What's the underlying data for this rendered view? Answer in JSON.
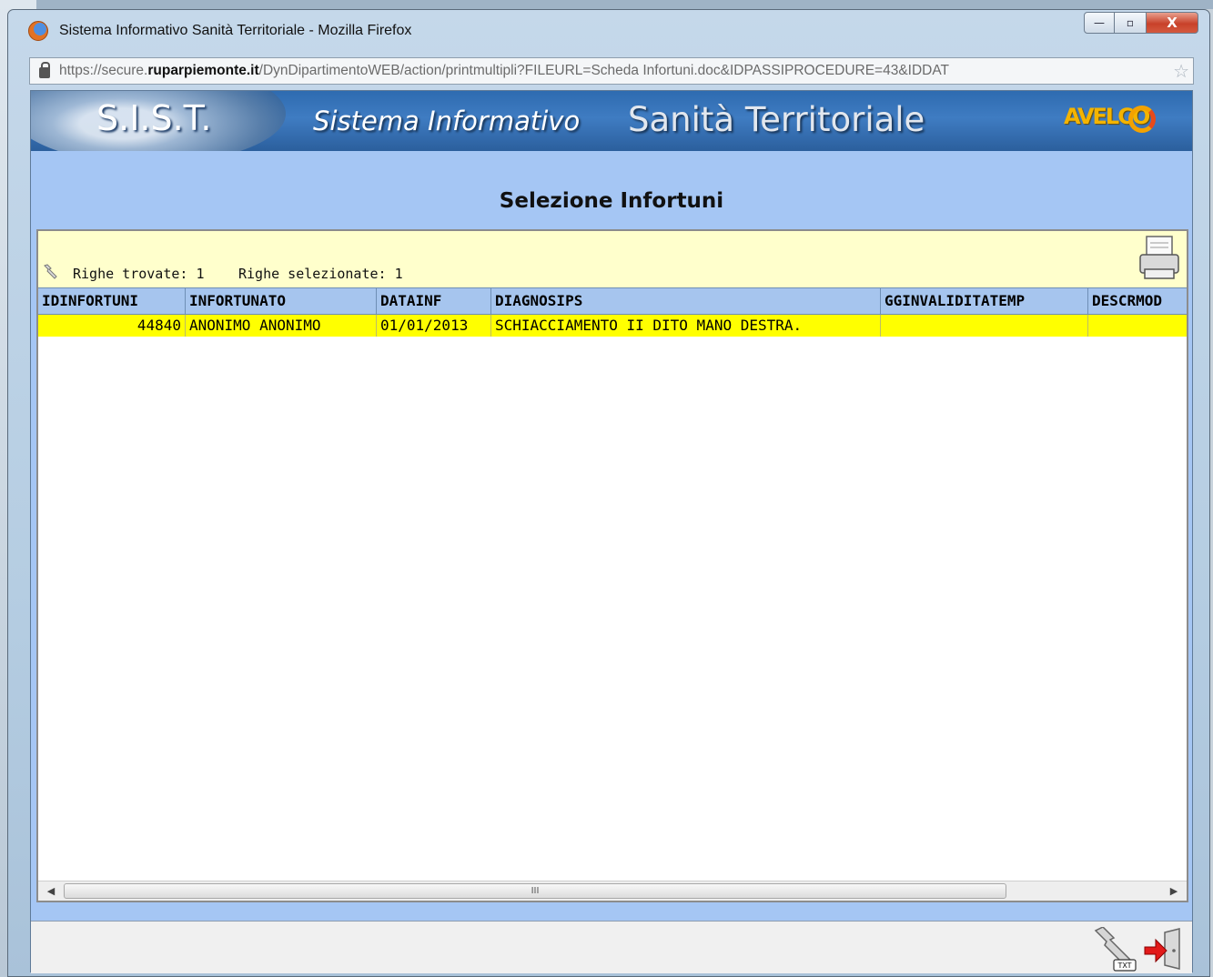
{
  "window": {
    "title": "Sistema Informativo Sanità Territoriale - Mozilla Firefox",
    "buttons": {
      "minimize": "—",
      "maximize": "▫",
      "close": "X"
    }
  },
  "urlbar": {
    "scheme_host_prefix": "https://secure.",
    "domain": "ruparpiemonte.it",
    "path": "/DynDipartimentoWEB/action/printmultipli?FILEURL=Scheda Infortuni.doc&IDPASSIPROCEDURE=43&IDDAT"
  },
  "banner": {
    "logo": "S.I.S.T.",
    "title_part1": "Sistema Informativo",
    "title_part2": "Sanità Territoriale",
    "brand": "AVELCO"
  },
  "page": {
    "title": "Selezione Infortuni"
  },
  "grid": {
    "rows_found_label": "Righe trovate: 1",
    "rows_selected_label": "Righe selezionate: 1",
    "columns": [
      "IDINFORTUNI",
      "INFORTUNATO",
      "DATAINF",
      "DIAGNOSIPS",
      "GGINVALIDITATEMP",
      "DESCRMOD"
    ],
    "rows": [
      [
        "44840",
        "ANONIMO ANONIMO",
        "01/01/2013",
        "SCHIACCIAMENTO II DITO MANO DESTRA.",
        "",
        ""
      ]
    ]
  },
  "scrollbar": {
    "thumb_grip": "III",
    "left_arrow": "◀",
    "right_arrow": "▶"
  },
  "icons": {
    "wrench": "wrench-icon",
    "printer": "printer-icon",
    "txt_export": "txt-tool-icon",
    "exit": "exit-icon"
  },
  "txt_badge": "TXT"
}
